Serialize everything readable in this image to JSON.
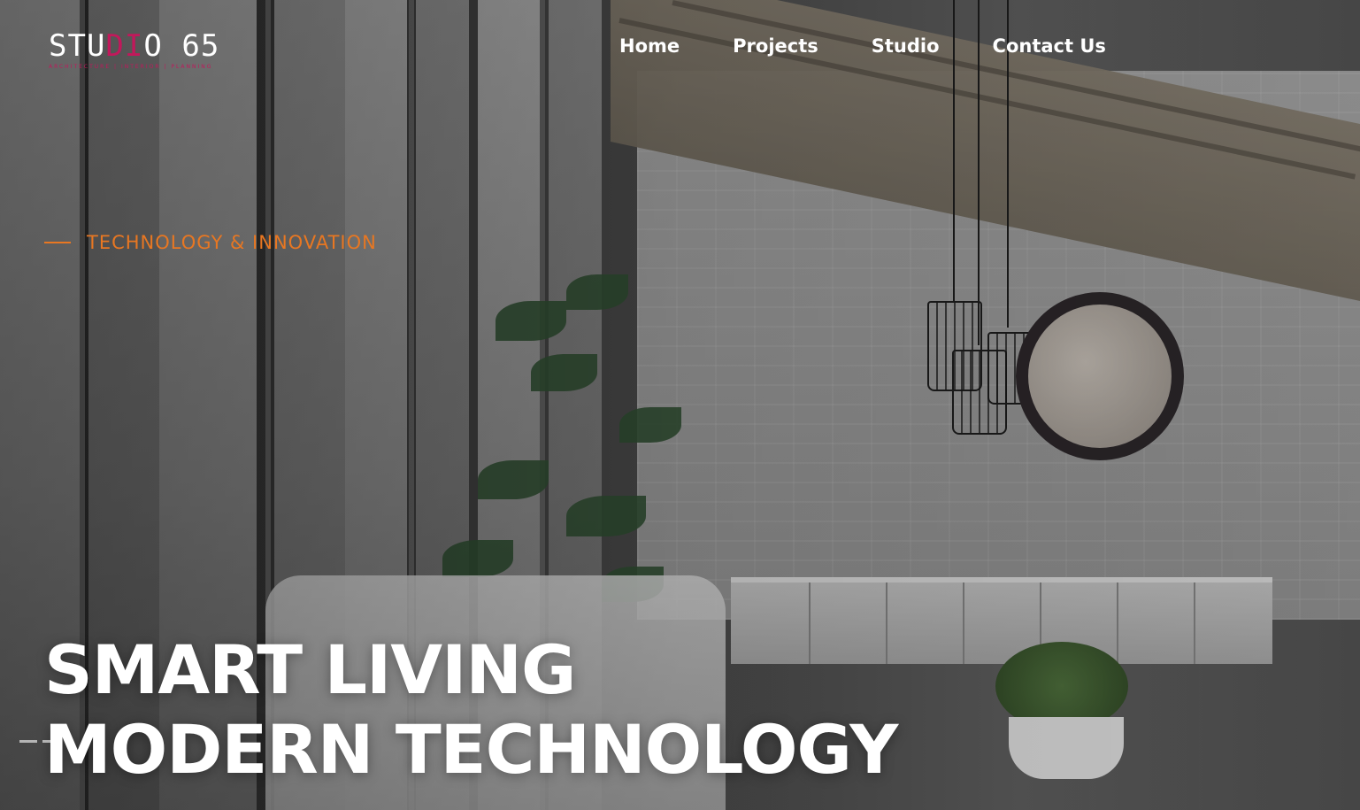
{
  "brand": {
    "name_left": "STU",
    "name_mark": "DI",
    "name_o": "O",
    "name_right": "65",
    "subtitle": "ARCHITECTURE | INTERIOR | PLANNING",
    "accent_color": "#c2185b"
  },
  "nav": {
    "items": [
      {
        "label": "Home"
      },
      {
        "label": "Projects"
      },
      {
        "label": "Studio"
      },
      {
        "label": "Contact Us"
      }
    ]
  },
  "hero": {
    "tagline": "TECHNOLOGY & INNOVATION",
    "tagline_color": "#e87722",
    "headline_line1": "SMART LIVING",
    "headline_line2": "MODERN TECHNOLOGY"
  },
  "icons": {
    "tagline_dash": "dash-icon"
  }
}
